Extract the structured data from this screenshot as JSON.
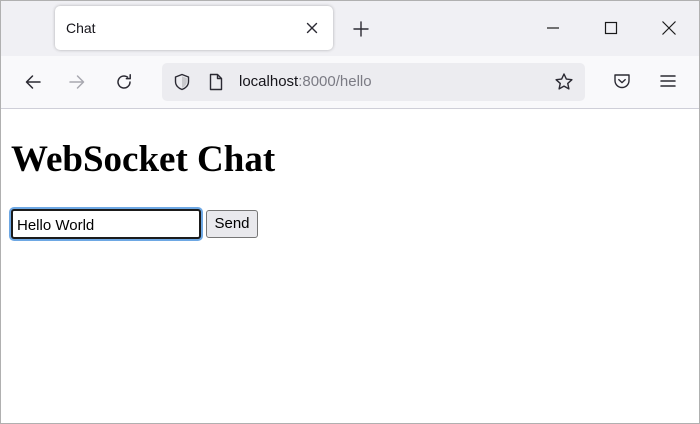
{
  "browser": {
    "tab": {
      "title": "Chat"
    },
    "address": {
      "host": "localhost",
      "rest": ":8000/hello"
    }
  },
  "page": {
    "heading": "WebSocket Chat",
    "input": {
      "value": "Hello World"
    },
    "send_label": "Send"
  },
  "colors": {
    "tabstrip_bg": "#f0f0f4",
    "toolbar_bg": "#f9f9fb",
    "urlbar_bg": "#ececf0",
    "focus_ring": "#6ea8e4",
    "button_bg": "#e9e9ed"
  },
  "icons": {
    "tab_close": "close-icon",
    "new_tab": "plus-icon",
    "minimize": "minimize-icon",
    "maximize": "maximize-icon",
    "close_window": "close-icon",
    "back": "arrow-left-icon",
    "forward": "arrow-right-icon",
    "reload": "reload-icon",
    "tracking_protection": "shield-icon",
    "page_info": "page-icon",
    "bookmark": "star-icon",
    "pocket": "pocket-icon",
    "menu": "hamburger-menu-icon"
  }
}
